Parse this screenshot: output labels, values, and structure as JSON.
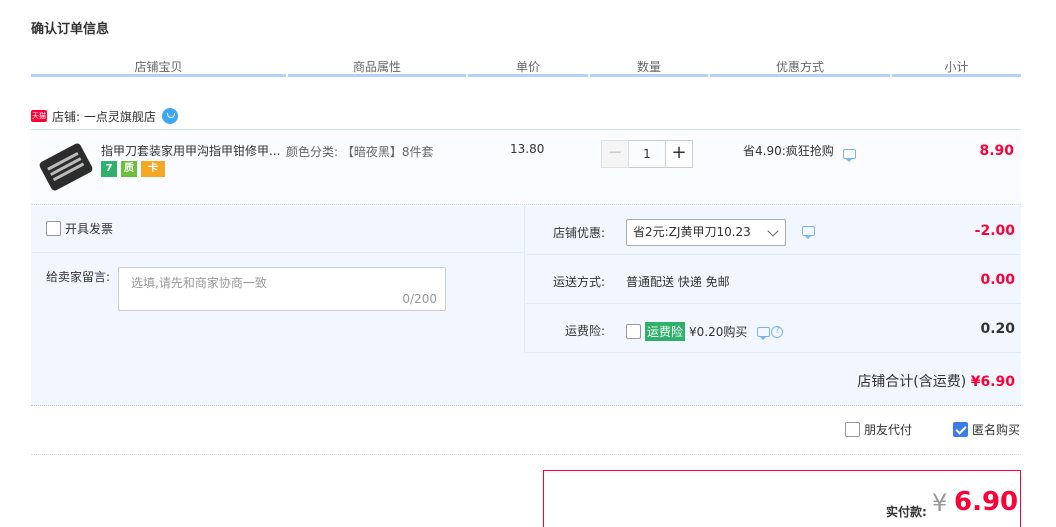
{
  "page": {
    "title": "确认订单信息"
  },
  "columns": [
    "店铺宝贝",
    "商品属性",
    "单价",
    "数量",
    "优惠方式",
    "小计"
  ],
  "shop": {
    "badge": "天猫",
    "name": "店铺: 一点灵旗舰店"
  },
  "item": {
    "title": "指甲刀套装家用甲沟指甲钳修甲...",
    "badges": [
      "7",
      "质",
      "卡"
    ],
    "property": "颜色分类: 【暗夜黑】8件套",
    "price": "13.80",
    "quantity": "1",
    "qty_minus": "−",
    "qty_plus": "+",
    "discount": "省4.90:疯狂抢购",
    "subtotal": "8.90"
  },
  "invoice": {
    "label": "开具发票"
  },
  "note": {
    "label": "给卖家留言:",
    "placeholder": "选填,请先和商家协商一致",
    "counter": "0/200"
  },
  "shop_discount": {
    "label": "店铺优惠:",
    "selected": "省2元:ZJ黄甲刀10.23",
    "amount": "-2.00"
  },
  "shipping": {
    "label": "运送方式:",
    "value": "普通配送 快递 免邮",
    "amount": "0.00"
  },
  "insurance": {
    "label": "运费险:",
    "tag": "运费险",
    "value": "¥0.20购买",
    "amount": "0.20"
  },
  "shop_total": {
    "label": "店铺合计(含运费)",
    "amount": "¥6.90"
  },
  "options": {
    "friend_pay": "朋友代付",
    "anonymous": "匿名购买",
    "anonymous_checked": true
  },
  "payment": {
    "label": "实付款:",
    "currency": "¥",
    "amount": "6.90"
  },
  "colors": {
    "accent": "#ff0036",
    "header_line": "#b2d1ff",
    "panel_bg": "#f2f7ff"
  }
}
